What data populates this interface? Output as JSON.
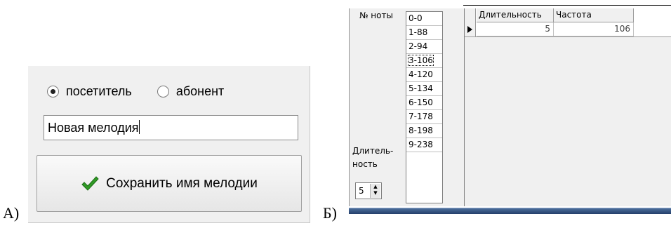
{
  "figure_labels": {
    "a": "А)",
    "b": "Б)"
  },
  "panel_a": {
    "radio_visitor": {
      "label": "посетитель",
      "checked": true
    },
    "radio_subscriber": {
      "label": "абонент",
      "checked": false
    },
    "name_field": {
      "value": "Новая мелодия"
    },
    "save_button": {
      "label": "Сохранить имя мелодии",
      "icon": "checkmark-icon"
    }
  },
  "panel_b": {
    "note_label": "№ ноты",
    "duration_label_1": "Длитель-",
    "duration_label_2": "ность",
    "notes": [
      "0-0",
      "1-88",
      "2-94",
      "3-106",
      "4-120",
      "5-134",
      "6-150",
      "7-178",
      "8-198",
      "9-238"
    ],
    "focused_note_index": 3,
    "duration_spinner": {
      "value": "5"
    },
    "grid": {
      "columns": [
        "Длительность",
        "Частота"
      ],
      "rows": [
        {
          "duration": "5",
          "frequency": "106"
        }
      ]
    }
  }
}
